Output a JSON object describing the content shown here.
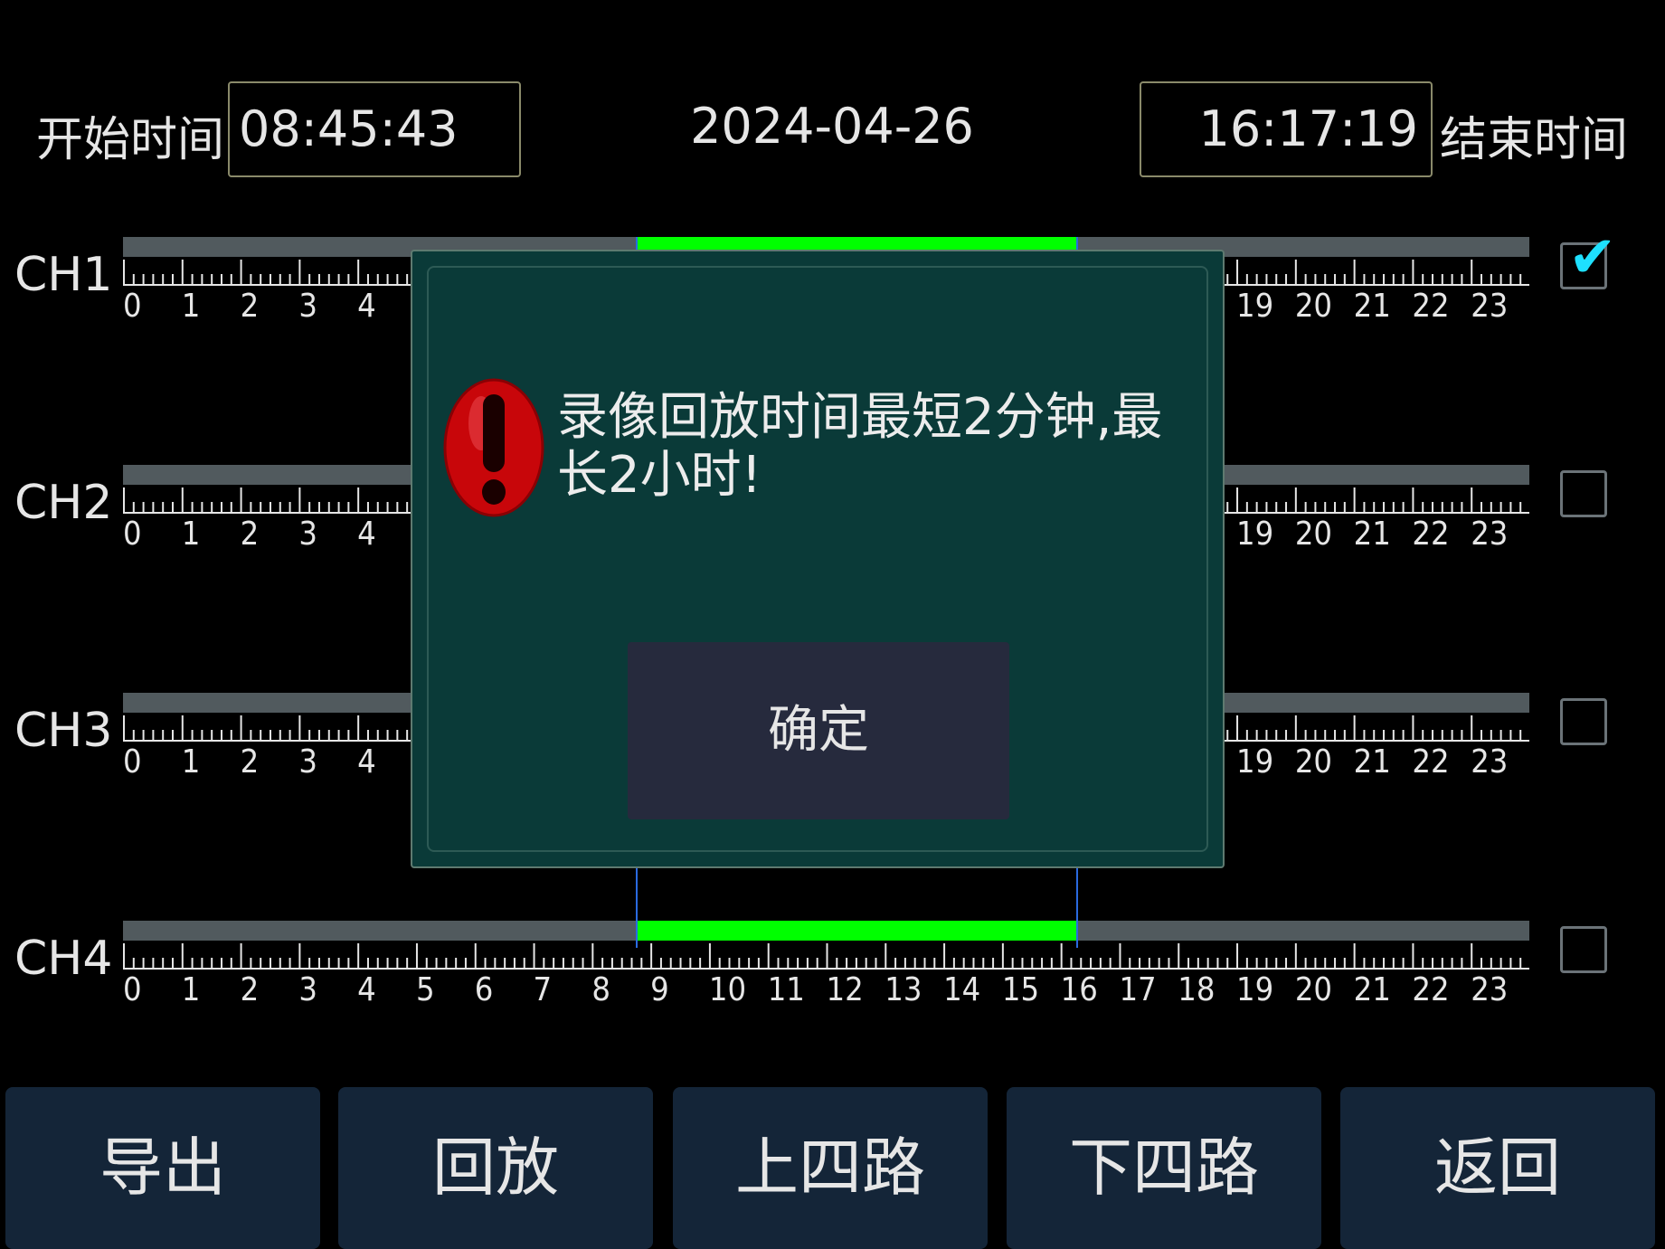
{
  "header": {
    "start_label": "开始时间",
    "start_time": "08:45:43",
    "date": "2024-04-26",
    "end_time": "16:17:19",
    "end_label": "结束时间"
  },
  "timeline": {
    "hours": [
      "0",
      "1",
      "2",
      "3",
      "4",
      "5",
      "6",
      "7",
      "8",
      "9",
      "10",
      "11",
      "12",
      "13",
      "14",
      "15",
      "16",
      "17",
      "18",
      "19",
      "20",
      "21",
      "22",
      "23"
    ],
    "selection_start_hour": 8.762,
    "selection_end_hour": 16.288,
    "colors": {
      "track": "#515a5e",
      "recording": "#00ff00",
      "marker": "#2a6ae0"
    }
  },
  "channels": [
    {
      "label": "CH1",
      "checked": true
    },
    {
      "label": "CH2",
      "checked": false
    },
    {
      "label": "CH3",
      "checked": false
    },
    {
      "label": "CH4",
      "checked": false
    }
  ],
  "dialog": {
    "message": "录像回放时间最短2分钟,最长2小时!",
    "ok_label": "确定",
    "icon": "exclamation-icon"
  },
  "buttons": {
    "export": "导出",
    "playback": "回放",
    "prev_four": "上四路",
    "next_four": "下四路",
    "back": "返回"
  }
}
